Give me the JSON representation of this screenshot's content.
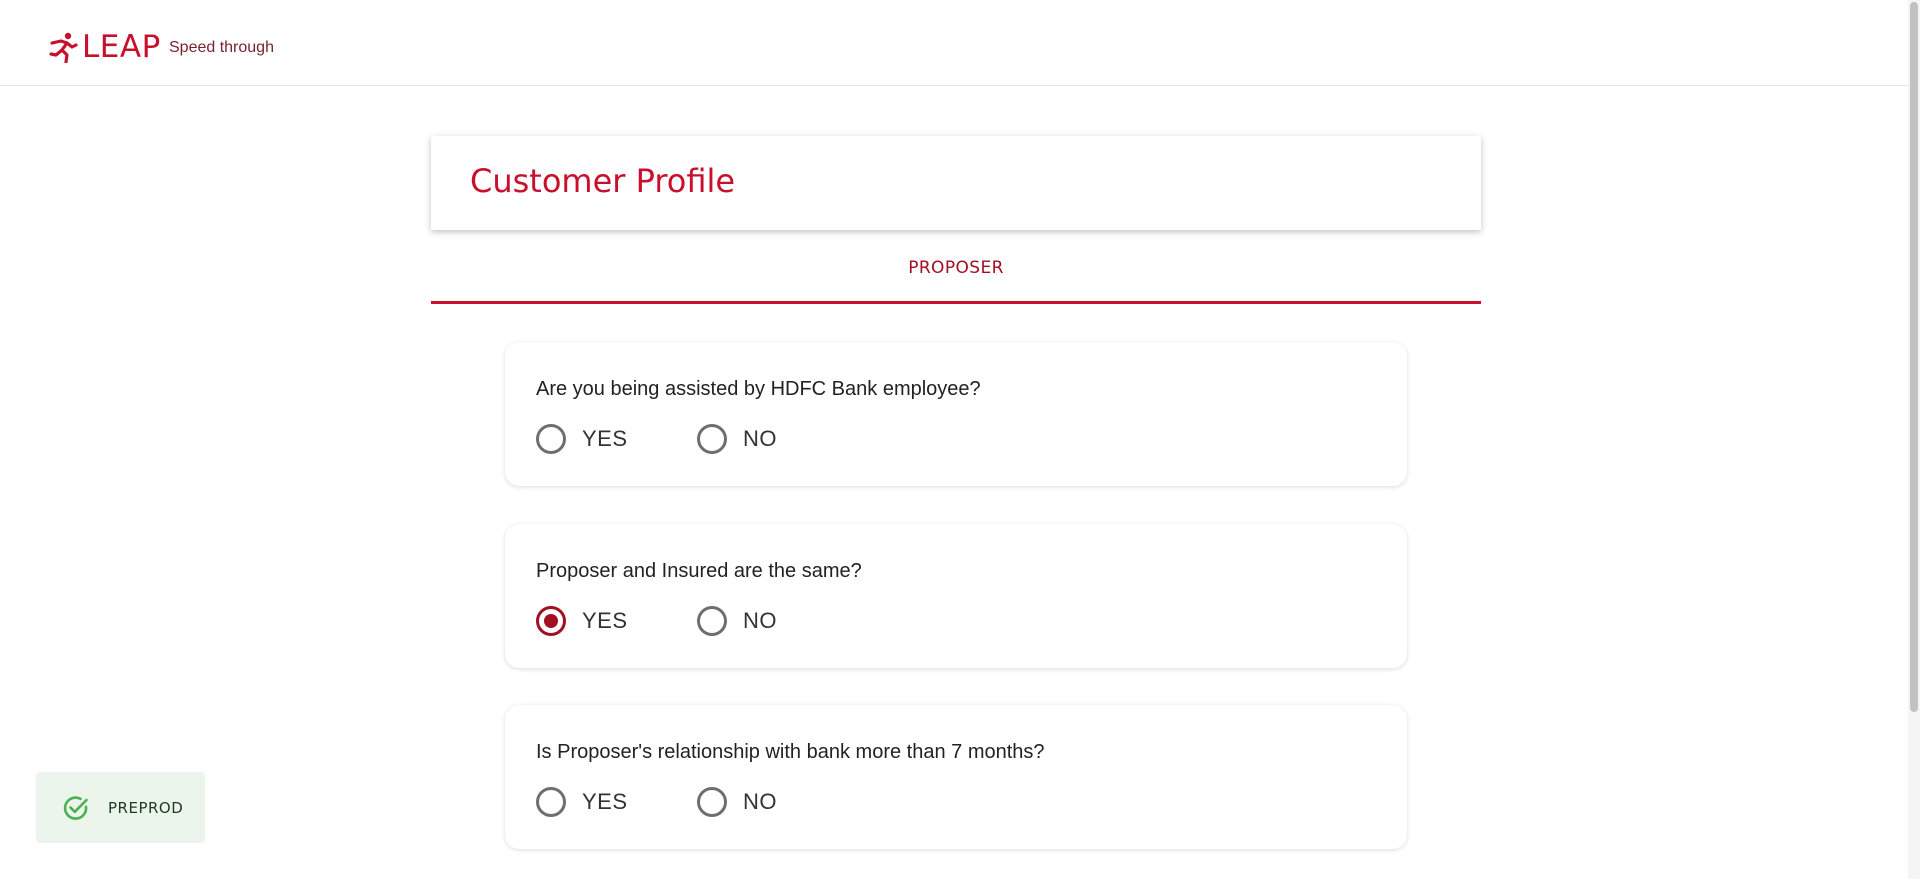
{
  "header": {
    "logo_text": "LEAP",
    "tagline": "Speed through"
  },
  "page": {
    "title": "Customer Profile"
  },
  "tabs": [
    {
      "label": "PROPOSER",
      "active": true
    }
  ],
  "questions": [
    {
      "text": "Are you being assisted by HDFC Bank employee?",
      "options": [
        "YES",
        "NO"
      ],
      "selected": null
    },
    {
      "text": "Proposer and Insured are the same?",
      "options": [
        "YES",
        "NO"
      ],
      "selected": "YES"
    },
    {
      "text": "Is Proposer's relationship with bank more than 7 months?",
      "options": [
        "YES",
        "NO"
      ],
      "selected": null
    }
  ],
  "env_badge": {
    "label": "PREPROD",
    "icon": "check-circle-icon"
  },
  "colors": {
    "brand": "#c8102e",
    "radio_selected": "#a10f22",
    "badge_bg": "#ebf5ec",
    "badge_icon": "#4caf50"
  }
}
